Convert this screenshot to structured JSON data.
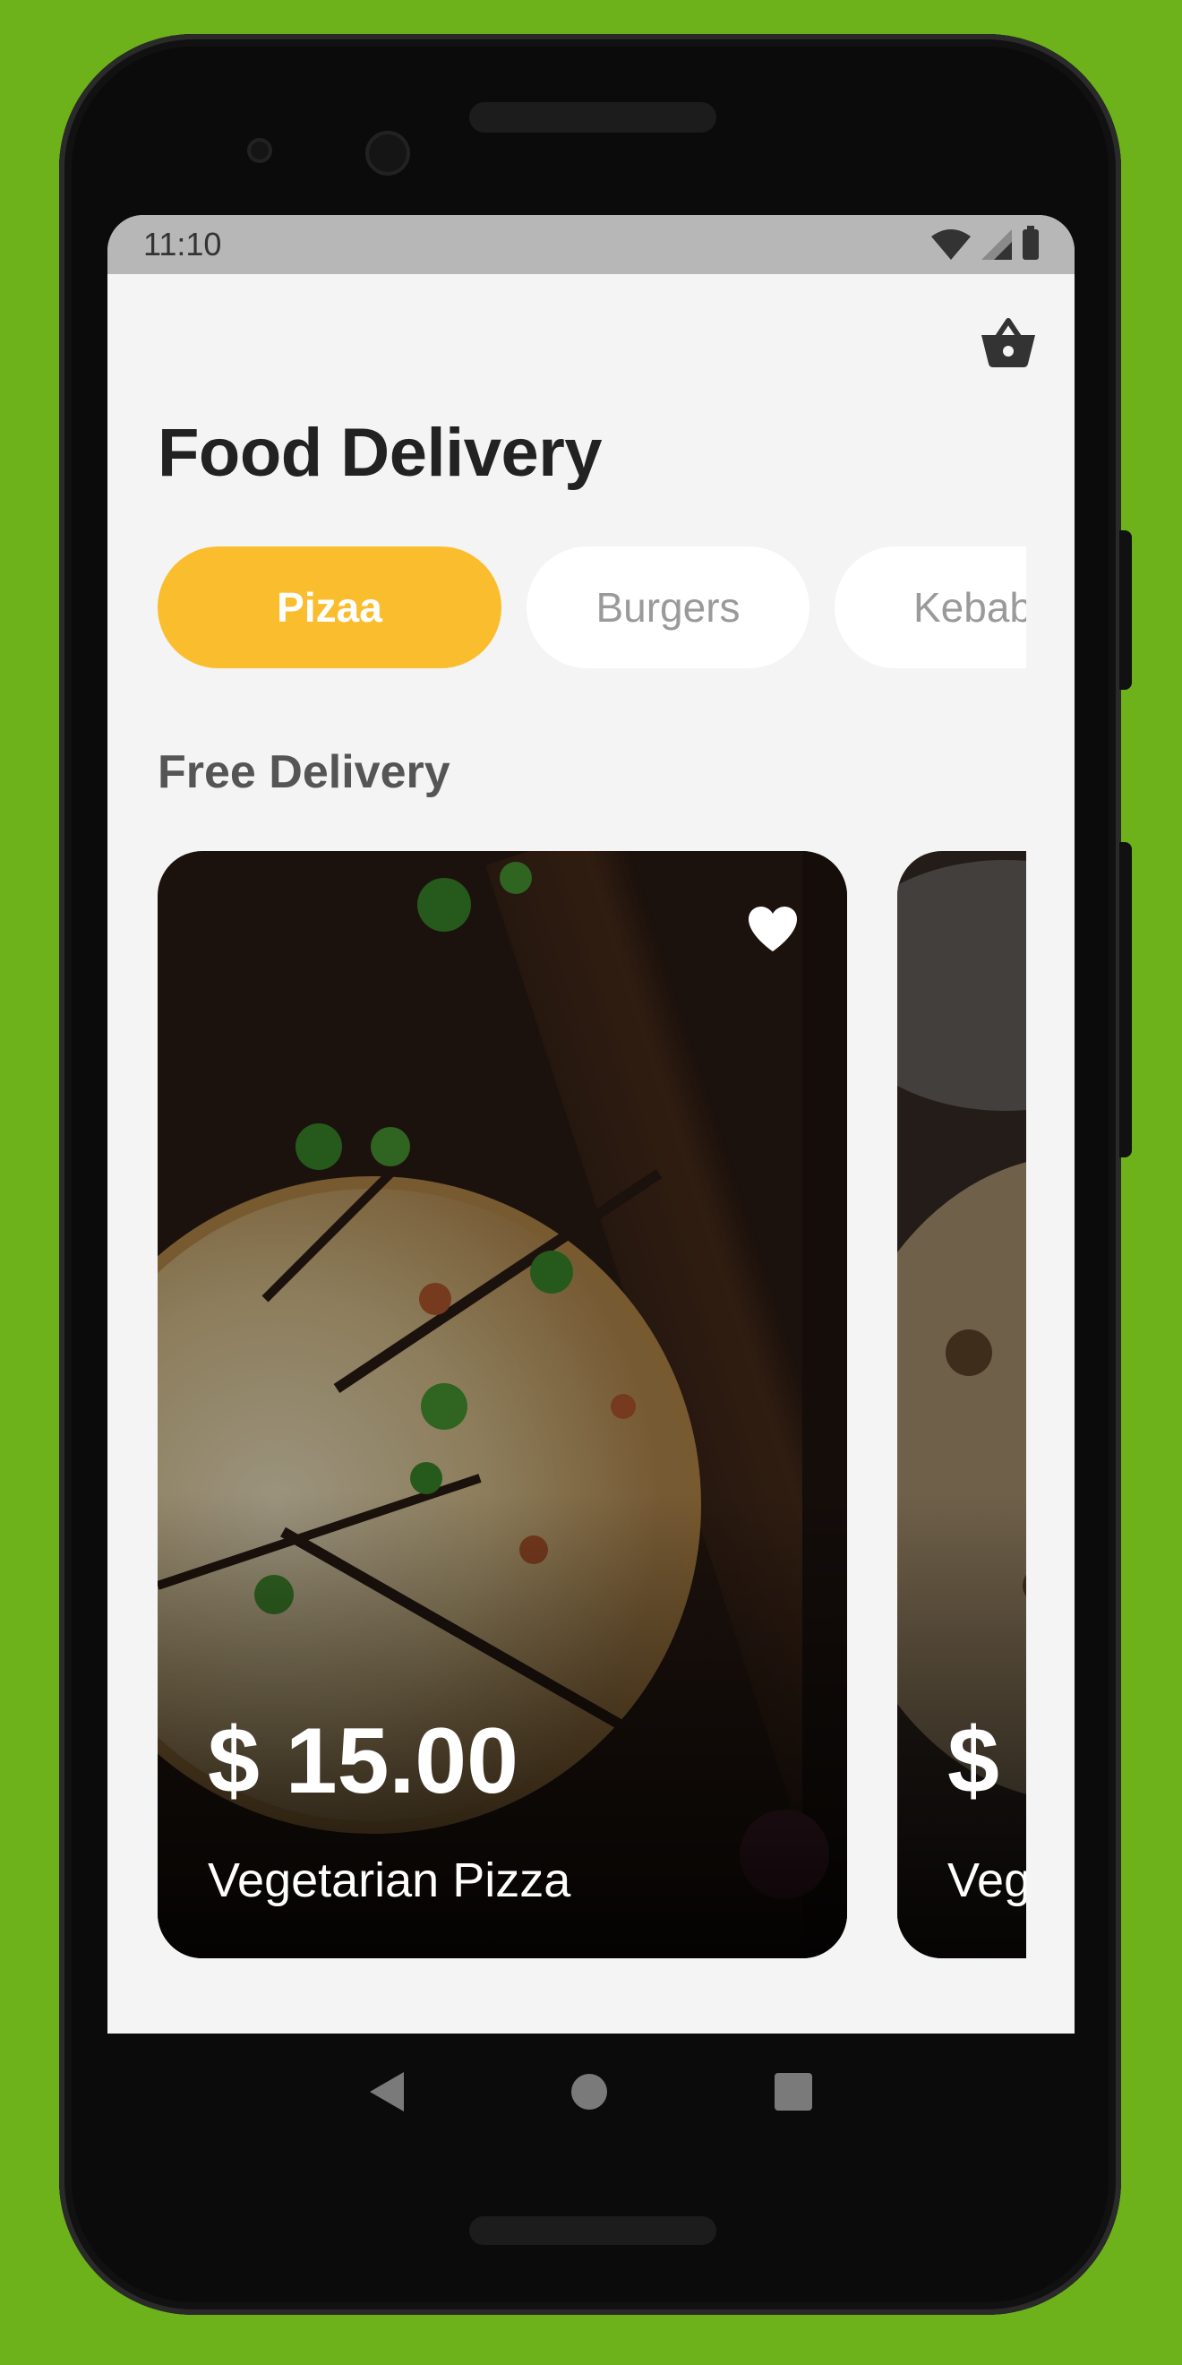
{
  "status_bar": {
    "time": "11:10"
  },
  "header": {
    "title": "Food Delivery",
    "cart_icon": "basket-icon"
  },
  "categories": [
    {
      "label": "Pizaa",
      "selected": true
    },
    {
      "label": "Burgers",
      "selected": false
    },
    {
      "label": "Kebab",
      "selected": false
    }
  ],
  "section": {
    "title": "Free Delivery"
  },
  "cards": [
    {
      "price": "$ 15.00",
      "name": "Vegetarian Pizza",
      "favorite": true
    },
    {
      "price": "$",
      "name": "Veg"
    }
  ],
  "colors": {
    "background": "#6db21a",
    "accent": "#fabd2e",
    "screen": "#f4f4f4"
  }
}
